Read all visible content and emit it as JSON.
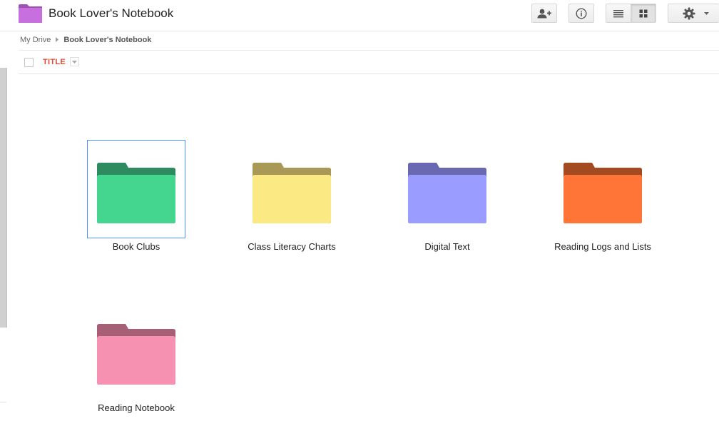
{
  "header": {
    "title": "Book Lover's Notebook",
    "folder_color": "#c86fe0",
    "folder_tab_color": "#9d54b0"
  },
  "toolbar": {
    "share_icon": "add-person-icon",
    "info_icon": "info-icon",
    "list_view_icon": "list-view-icon",
    "grid_view_icon": "grid-view-icon",
    "grid_view_active": true,
    "settings_icon": "gear-icon"
  },
  "breadcrumb": {
    "root": "My Drive",
    "current": "Book Lover's Notebook"
  },
  "columns": {
    "title": "TITLE"
  },
  "folders": [
    {
      "name": "Book Clubs",
      "back": "#2d8b5f",
      "front": "#44d58e",
      "selected": true
    },
    {
      "name": "Class Literacy Charts",
      "back": "#a89a56",
      "front": "#fbe983",
      "selected": false
    },
    {
      "name": "Digital Text",
      "back": "#6968b0",
      "front": "#9a9cff",
      "selected": false
    },
    {
      "name": "Reading Logs and Lists",
      "back": "#a44a20",
      "front": "#ff7537",
      "selected": false
    },
    {
      "name": "Reading Notebook",
      "back": "#a65f75",
      "front": "#f691b2",
      "selected": false
    }
  ]
}
